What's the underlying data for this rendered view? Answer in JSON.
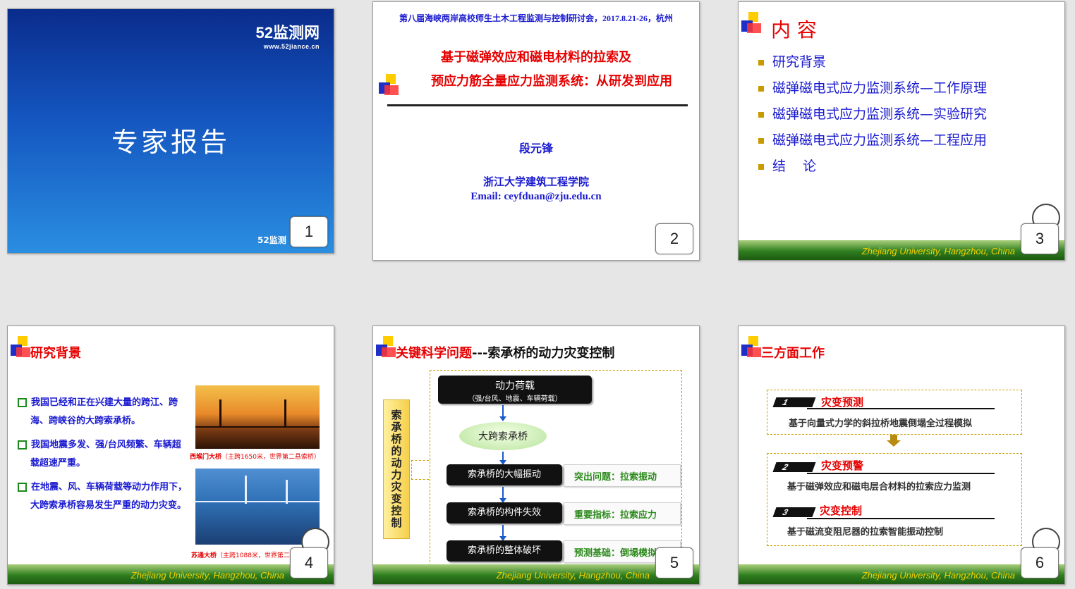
{
  "slides": [
    {
      "number": "1",
      "logo_main": "52监测网",
      "logo_url": "www.52jiance.cn",
      "title": "专家报告",
      "corner_text": "52监测"
    },
    {
      "number": "2",
      "conference": "第八届海峡两岸高校师生土木工程监测与控制研讨会，2017.8.21-26，杭州",
      "title_line1": "基于磁弹效应和磁电材料的拉索及",
      "title_line2": "预应力筋全量应力监测系统：从研发到应用",
      "author": "段元锋",
      "affiliation": "浙江大学建筑工程学院",
      "email": "Email: ceyfduan@zju.edu.cn"
    },
    {
      "number": "3",
      "title": "内  容",
      "items": [
        "研究背景",
        "磁弹磁电式应力监测系统—工作原理",
        "磁弹磁电式应力监测系统—实验研究",
        "磁弹磁电式应力监测系统—工程应用",
        "结    论"
      ],
      "footer": "Zhejiang University, Hangzhou, China"
    },
    {
      "number": "4",
      "title": "研究背景",
      "bullets": [
        "我国已经和正在兴建大量的跨江、跨海、跨峡谷的大跨索承桥。",
        "我国地震多发、强/台风频繁、车辆超载超速严重。",
        "在地震、风、车辆荷载等动力作用下，大跨索承桥容易发生严重的动力灾变。"
      ],
      "caption1_name": "西堠门大桥",
      "caption1_detail": "（主跨1650米，世界第二悬索桥）",
      "caption2_name": "苏通大桥",
      "caption2_detail": "（主跨1088米，世界第二斜拉桥）",
      "footer": "Zhejiang University, Hangzhou, China"
    },
    {
      "number": "5",
      "title_red": "关键科学问题",
      "title_black": "---索承桥的动力灾变控制",
      "side_label": "索承桥的动力灾变控制",
      "load_title": "动力荷载",
      "load_sub": "（强/台风、地震、车辆荷载）",
      "bridge": "大跨索承桥",
      "steps": [
        "索承桥的大幅振动",
        "索承桥的构件失效",
        "索承桥的整体破坏"
      ],
      "notes": [
        "突出问题：拉索振动",
        "重要指标：拉索应力",
        "预测基础：倒塌模拟"
      ],
      "footer": "Zhejiang University, Hangzhou, China"
    },
    {
      "number": "6",
      "title": "三方面工作",
      "works": [
        {
          "n": "1",
          "title": "灾变预测",
          "desc": "基于向量式力学的斜拉桥地震倒塌全过程模拟"
        },
        {
          "n": "2",
          "title": "灾变预警",
          "desc": "基于磁弹效应和磁电层合材料的拉索应力监测"
        },
        {
          "n": "3",
          "title": "灾变控制",
          "desc": "基于磁流变阻尼器的拉索智能振动控制"
        }
      ],
      "footer": "Zhejiang University, Hangzhou, China"
    }
  ]
}
